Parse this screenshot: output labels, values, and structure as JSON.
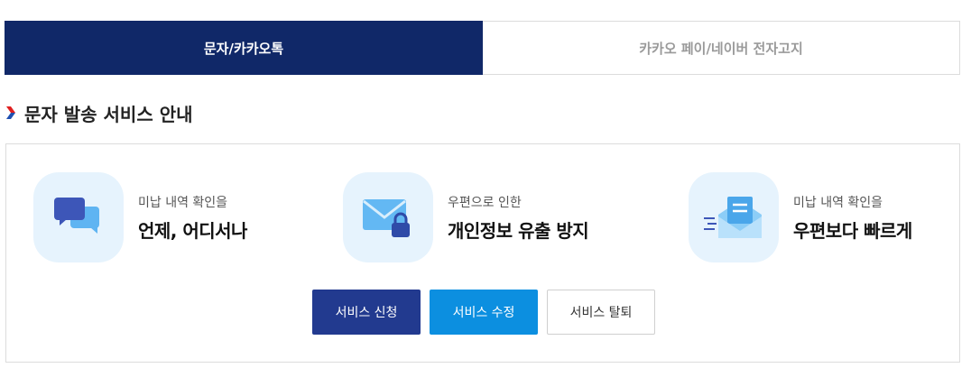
{
  "tabs": [
    {
      "label": "문자/카카오톡"
    },
    {
      "label": "카카오 페이/네이버 전자고지"
    }
  ],
  "section": {
    "title": "문자 발송 서비스 안내"
  },
  "features": [
    {
      "sub": "미납 내역 확인을",
      "main": "언제, 어디서나",
      "icon": "chat-bubbles-icon"
    },
    {
      "sub": "우편으로 인한",
      "main": "개인정보 유출 방지",
      "icon": "locked-envelope-icon"
    },
    {
      "sub": "미납 내역 확인을",
      "main": "우편보다 빠르게",
      "icon": "fast-mail-icon"
    }
  ],
  "buttons": {
    "apply": "서비스 신청",
    "modify": "서비스 수정",
    "withdraw": "서비스 탈퇴"
  },
  "colors": {
    "tab_active": "#102868",
    "apply_button": "#223a8f",
    "modify_button": "#0c8fe0",
    "chevron_red": "#e02020",
    "chevron_blue": "#1f4fb0",
    "icon_bg": "#e6f3fd"
  }
}
